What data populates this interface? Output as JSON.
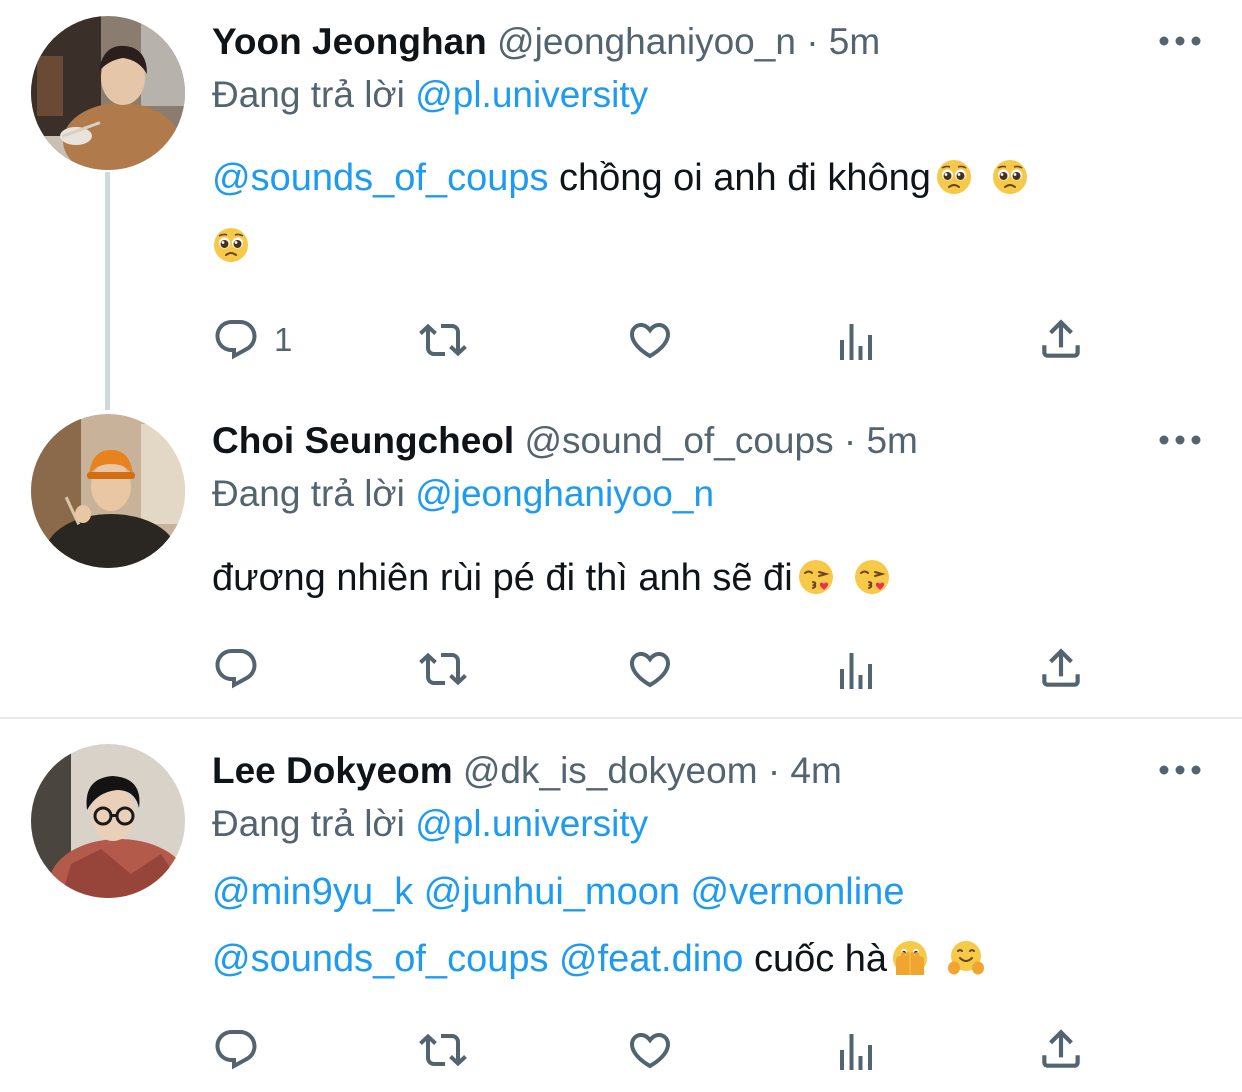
{
  "tweets": [
    {
      "name": "Yoon Jeonghan",
      "handle": "@jeonghaniyoo_n",
      "separator": "·",
      "time": "5m",
      "reply_prefix": "Đang trả lời",
      "reply_to": "@pl.university",
      "body_mention": "@sounds_of_coups",
      "body_text": " chồng oi anh đi không",
      "emoji": "pleading-face-emoji",
      "reply_count": "1"
    },
    {
      "name": "Choi Seungcheol",
      "handle": "@sound_of_coups",
      "separator": "·",
      "time": "5m",
      "reply_prefix": "Đang trả lời",
      "reply_to": "@jeonghaniyoo_n",
      "body_text": "đương nhiên rùi pé đi thì anh sẽ đi",
      "emoji": "face-blowing-kiss-emoji",
      "reply_count": ""
    },
    {
      "name": "Lee Dokyeom",
      "handle": "@dk_is_dokyeom",
      "separator": "·",
      "time": "4m",
      "reply_prefix": "Đang trả lời",
      "reply_to": "@pl.university",
      "mentions_line1": [
        "@min9yu_k",
        "@junhui_moon",
        "@vernonline"
      ],
      "mentions_line2": [
        "@sounds_of_coups",
        "@feat.dino"
      ],
      "body_text": " cuốc hà",
      "emoji": [
        "face-with-open-eyes-and-hand-over-mouth-emoji",
        "hugging-face-emoji"
      ],
      "reply_count": ""
    }
  ],
  "icons": {
    "more": "more-horizontal-icon",
    "reply": "reply-icon",
    "retweet": "retweet-icon",
    "like": "heart-icon",
    "views": "analytics-icon",
    "share": "share-icon"
  },
  "colors": {
    "mention": "#1d9bf0",
    "secondary_text": "#536471",
    "thread_line": "#cfd9de",
    "divider": "#e7e9ea"
  }
}
